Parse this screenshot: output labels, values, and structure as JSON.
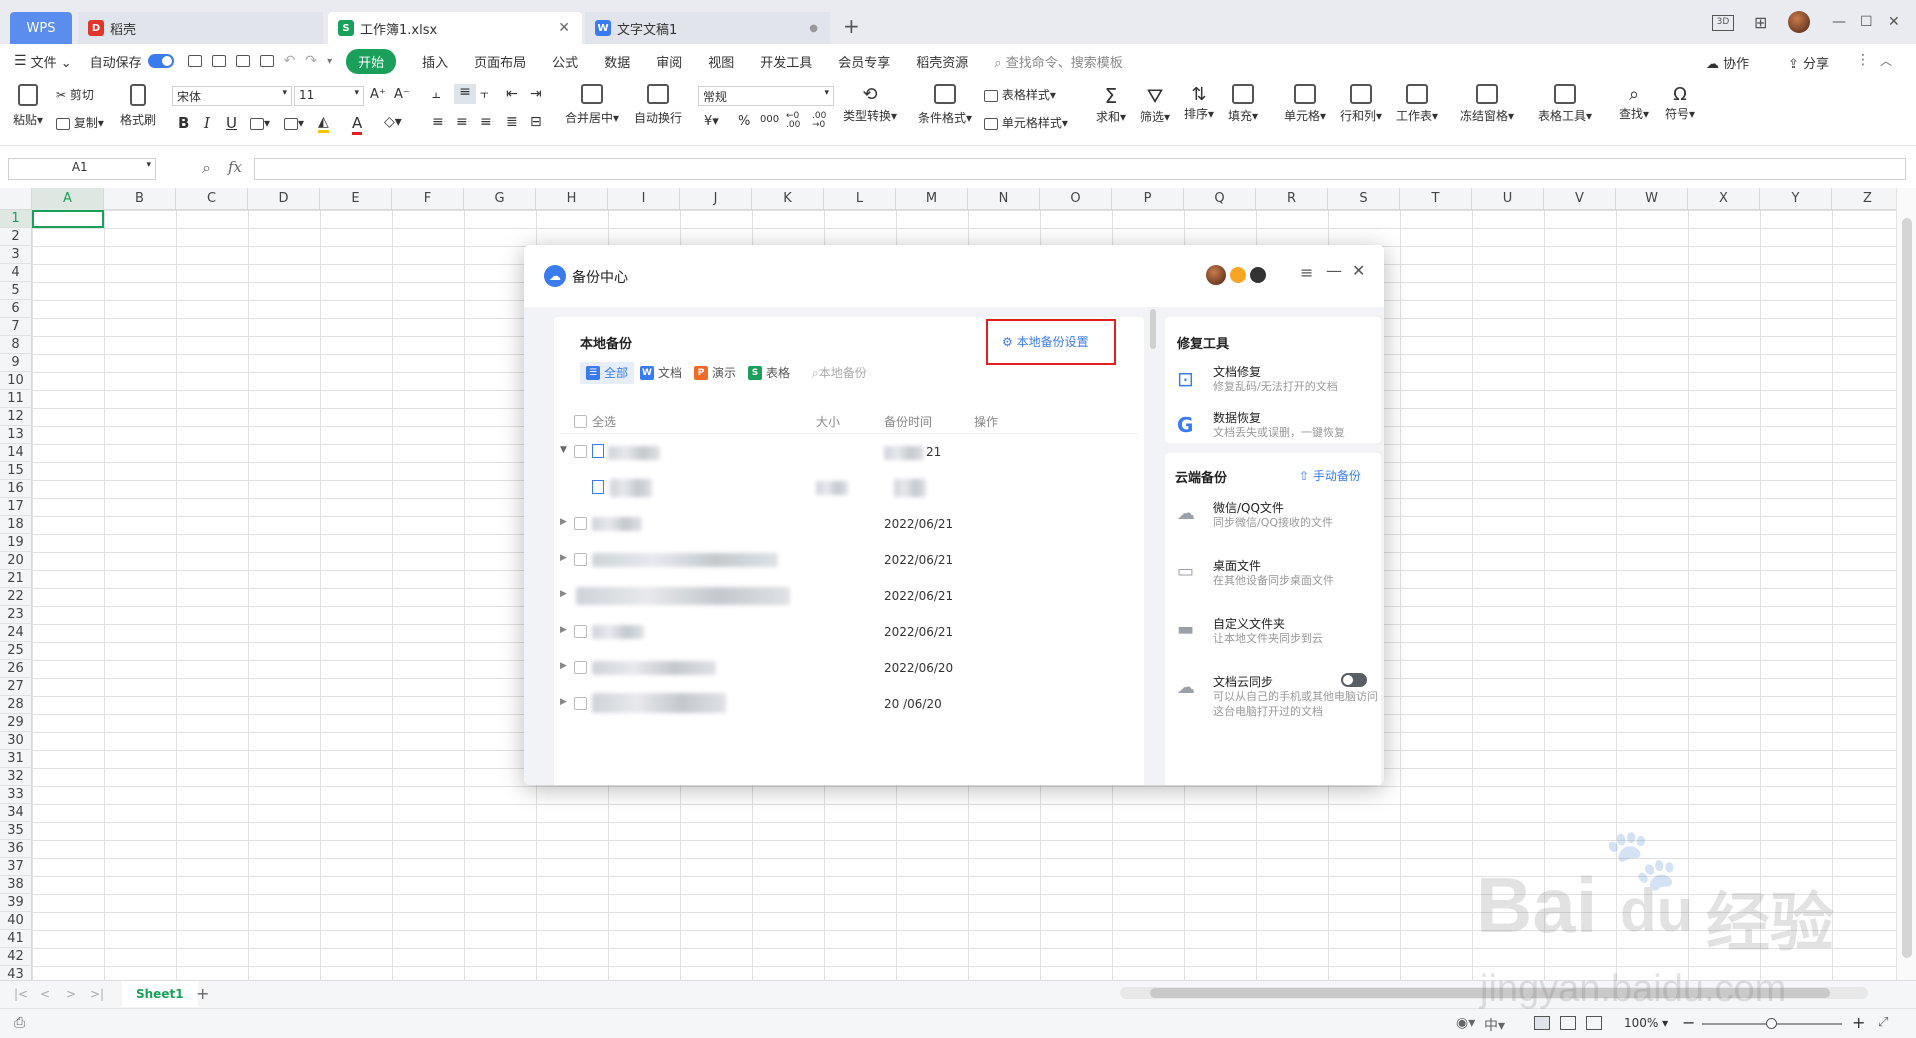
{
  "titlebar": {
    "wps_label": "WPS",
    "tabs": [
      {
        "label": "稻壳"
      },
      {
        "label": "工作簿1.xlsx"
      },
      {
        "label": "文字文稿1"
      }
    ],
    "new_tab": "+",
    "badge_3d": "3D"
  },
  "menubar": {
    "file": "文件",
    "autosave": "自动保存",
    "items": [
      "开始",
      "插入",
      "页面布局",
      "公式",
      "数据",
      "审阅",
      "视图",
      "开发工具",
      "会员专享",
      "稻壳资源"
    ],
    "search": "查找命令、搜索模板",
    "collab": "协作",
    "share": "分享"
  },
  "ribbon": {
    "paste": "粘贴",
    "cut": "剪切",
    "copy": "复制",
    "format_painter": "格式刷",
    "font_name": "宋体",
    "font_size": "11",
    "merge_center": "合并居中",
    "wrap": "自动换行",
    "number_format": "常规",
    "type_convert": "类型转换",
    "cond_format": "条件格式",
    "table_style": "表格样式",
    "cell_style": "单元格样式",
    "sum": "求和",
    "filter": "筛选",
    "sort": "排序",
    "fill": "填充",
    "cell": "单元格",
    "row_col": "行和列",
    "worksheet": "工作表",
    "freeze": "冻结窗格",
    "table_tools": "表格工具",
    "find": "查找",
    "symbol": "符号"
  },
  "formulabar": {
    "name_box": "A1",
    "fx": "fx"
  },
  "grid": {
    "columns": [
      "A",
      "B",
      "C",
      "D",
      "E",
      "F",
      "G",
      "H",
      "I",
      "J",
      "K",
      "L",
      "M",
      "N",
      "O",
      "P",
      "Q",
      "R",
      "S",
      "T",
      "U",
      "V",
      "W",
      "X",
      "Y",
      "Z"
    ],
    "rows": [
      "1",
      "2",
      "3",
      "4",
      "5",
      "6",
      "7",
      "8",
      "9",
      "10",
      "11",
      "12",
      "13",
      "14",
      "15",
      "16",
      "17",
      "18",
      "19",
      "20",
      "21",
      "22",
      "23",
      "24",
      "25",
      "26",
      "27",
      "28",
      "29",
      "30",
      "31",
      "32",
      "33",
      "34",
      "35",
      "36",
      "37",
      "38",
      "39",
      "40",
      "41",
      "42",
      "43"
    ]
  },
  "sheetbar": {
    "sheet_name": "Sheet1",
    "add": "+"
  },
  "statusbar": {
    "zoom": "100%"
  },
  "dialog": {
    "title": "备份中心",
    "local": {
      "title": "本地备份",
      "settings_link": "本地备份设置",
      "filters": [
        "全部",
        "文档",
        "演示",
        "表格"
      ],
      "search_placeholder": "本地备份",
      "headers": {
        "select_all": "全选",
        "size": "大小",
        "time": "备份时间",
        "action": "操作"
      },
      "rows": [
        {
          "date": "21"
        },
        {
          "date": ""
        },
        {
          "date": "2022/06/21"
        },
        {
          "date": "2022/06/21"
        },
        {
          "date": "2022/06/21"
        },
        {
          "date": "2022/06/21"
        },
        {
          "date": "2022/06/20"
        },
        {
          "date": "20  /06/20"
        }
      ]
    },
    "repair": {
      "title": "修复工具",
      "tools": [
        {
          "name": "文档修复",
          "desc": "修复乱码/无法打开的文档"
        },
        {
          "name": "数据恢复",
          "desc": "文档丢失或误删，一键恢复"
        }
      ]
    },
    "cloud": {
      "title": "云端备份",
      "manual": "手动备份",
      "items": [
        {
          "name": "微信/QQ文件",
          "desc": "同步微信/QQ接收的文件"
        },
        {
          "name": "桌面文件",
          "desc": "在其他设备同步桌面文件"
        },
        {
          "name": "自定义文件夹",
          "desc": "让本地文件夹同步到云"
        },
        {
          "name": "文档云同步",
          "desc": "可以从自己的手机或其他电脑访问这台电脑打开过的文档"
        }
      ]
    }
  },
  "watermark": {
    "brand": "Bai",
    "brand2": "du",
    "cn": "经验",
    "url": "jingyan.baidu.com"
  },
  "colors": {
    "accent_green": "#1aa05a",
    "wps_blue": "#5b8def",
    "highlight_red": "#e02020",
    "link_blue": "#3a7bf0"
  }
}
